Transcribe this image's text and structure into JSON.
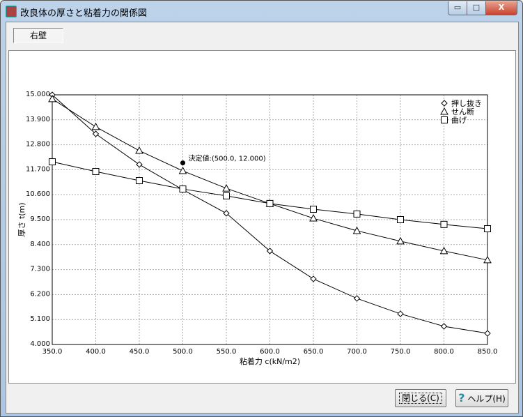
{
  "window": {
    "title": "改良体の厚さと粘着力の関係図",
    "minimize": "▭",
    "maximize": "□",
    "close": "X"
  },
  "tab_label": "右壁",
  "buttons": {
    "close": "閉じる(C)",
    "help": "ヘルプ(H)",
    "help_icon": "?"
  },
  "chart_data": {
    "type": "line",
    "title": "",
    "xlabel": "粘着力 c(kN/m2)",
    "ylabel": "厚さ t(m)",
    "xlim": [
      350,
      850
    ],
    "ylim": [
      4.0,
      15.0
    ],
    "x": [
      350,
      400,
      450,
      500,
      550,
      600,
      650,
      700,
      750,
      800,
      850
    ],
    "xticks": [
      "350.0",
      "400.0",
      "450.0",
      "500.0",
      "550.0",
      "600.0",
      "650.0",
      "700.0",
      "750.0",
      "800.0",
      "850.0"
    ],
    "yticks": [
      "4.000",
      "5.100",
      "6.200",
      "7.300",
      "8.400",
      "9.500",
      "10.600",
      "11.700",
      "12.800",
      "13.900",
      "15.000"
    ],
    "grid": true,
    "legend_position": "top-right",
    "series": [
      {
        "name": "押し抜き",
        "marker": "circle",
        "values": [
          15.0,
          13.28,
          11.93,
          10.82,
          9.78,
          8.12,
          6.89,
          6.03,
          5.35,
          4.8,
          4.49
        ]
      },
      {
        "name": "せん断",
        "marker": "triangle",
        "values": [
          14.82,
          13.59,
          12.54,
          11.65,
          10.88,
          10.21,
          9.56,
          9.01,
          8.55,
          8.12,
          7.72
        ]
      },
      {
        "name": "曲げ",
        "marker": "square",
        "values": [
          12.05,
          11.62,
          11.22,
          10.85,
          10.55,
          10.21,
          9.96,
          9.75,
          9.5,
          9.29,
          9.1
        ]
      }
    ],
    "annotation": {
      "label": "決定値:(500.0, 12.000)",
      "x": 500,
      "y": 12.0
    }
  }
}
